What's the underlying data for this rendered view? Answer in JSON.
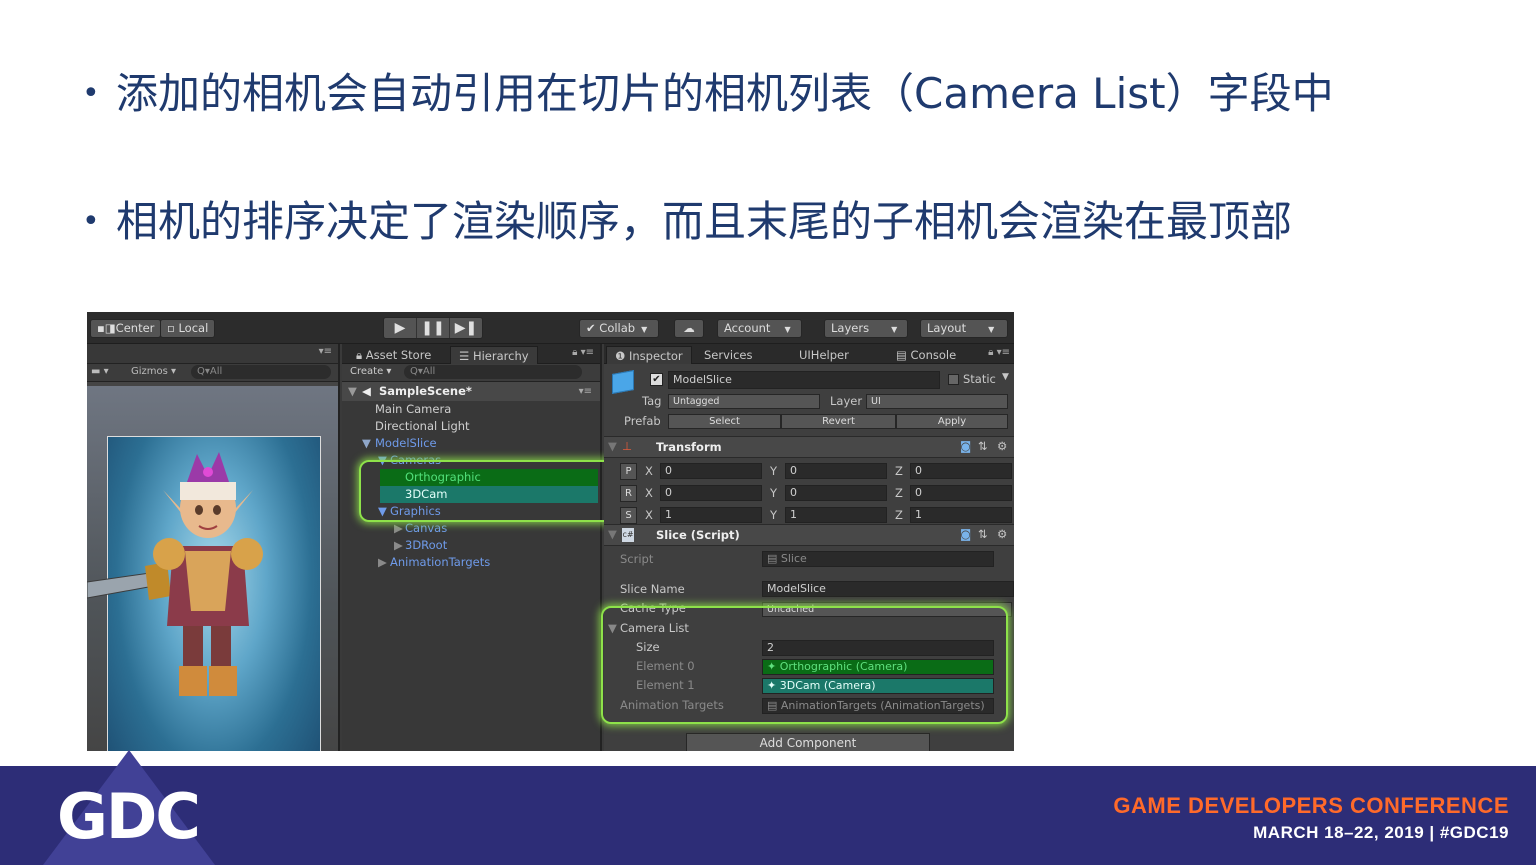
{
  "bullets": [
    {
      "text": "添加的相机会自动引用在切片的相机列表（Camera List）字段中"
    },
    {
      "text": "相机的排序决定了渲染顺序，而且末尾的子相机会渲染在最顶部"
    }
  ],
  "unity": {
    "toolbar": {
      "center": "Center",
      "local": "Local",
      "collab": "Collab",
      "account": "Account",
      "layers": "Layers",
      "layout": "Layout"
    },
    "scene": {
      "gizmos": "Gizmos",
      "search_placeholder": "Q▾All"
    },
    "hierarchy": {
      "tab_asset_store": "Asset Store",
      "tab_hierarchy": "Hierarchy",
      "create": "Create",
      "search_placeholder": "Q▾All",
      "scene_name": "SampleScene*",
      "items": [
        {
          "label": "Main Camera"
        },
        {
          "label": "Directional Light"
        },
        {
          "label": "ModelSlice"
        },
        {
          "label": "Cameras"
        },
        {
          "label": "Orthographic"
        },
        {
          "label": "3DCam"
        },
        {
          "label": "Graphics"
        },
        {
          "label": "Canvas"
        },
        {
          "label": "3DRoot"
        },
        {
          "label": "AnimationTargets"
        }
      ]
    },
    "inspector": {
      "tabs": [
        "Inspector",
        "Services",
        "UIHelper",
        "Console"
      ],
      "object_name": "ModelSlice",
      "static_label": "Static",
      "tag_label": "Tag",
      "tag_value": "Untagged",
      "layer_label": "Layer",
      "layer_value": "UI",
      "prefab_label": "Prefab",
      "prefab_select": "Select",
      "prefab_revert": "Revert",
      "prefab_apply": "Apply",
      "transform_title": "Transform",
      "transform": [
        {
          "key": "P",
          "x": "0",
          "y": "0",
          "z": "0"
        },
        {
          "key": "R",
          "x": "0",
          "y": "0",
          "z": "0"
        },
        {
          "key": "S",
          "x": "1",
          "y": "1",
          "z": "1"
        }
      ],
      "axis_x": "X",
      "axis_y": "Y",
      "axis_z": "Z",
      "slice_title": "Slice (Script)",
      "script_label": "Script",
      "script_value": "Slice",
      "slice_name_label": "Slice Name",
      "slice_name_value": "ModelSlice",
      "cache_type_label": "Cache Type",
      "cache_type_value": "Uncached",
      "camera_list_label": "Camera List",
      "size_label": "Size",
      "size_value": "2",
      "element0_label": "Element 0",
      "element0_value": "Orthographic (Camera)",
      "element1_label": "Element 1",
      "element1_value": "3DCam (Camera)",
      "anim_targets_label": "Animation Targets",
      "anim_targets_value": "AnimationTargets (AnimationTargets)",
      "add_component": "Add Component"
    }
  },
  "footer": {
    "logo_text": "GDC",
    "conference": "GAME DEVELOPERS CONFERENCE",
    "date": "MARCH 18–22, 2019  |  #GDC19"
  },
  "colors": {
    "bullet_text": "#1f3a6e",
    "footer_bg": "#2d2d77",
    "footer_accent": "#ff6a2a",
    "highlight_glow": "#8ee24a"
  }
}
